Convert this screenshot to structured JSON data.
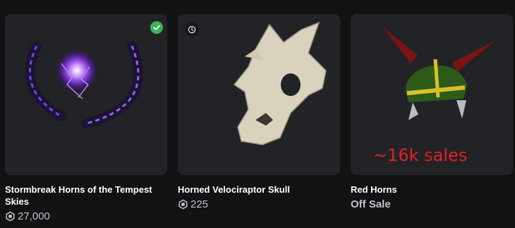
{
  "items": [
    {
      "name": "Stormbreak Horns of the Tempest Skies",
      "price": "27,000",
      "badge_icon": "checkmark-icon",
      "price_icon": "robux-icon"
    },
    {
      "name": "Horned Velociraptor Skull",
      "price": "225",
      "badge_icon": "clock-icon",
      "price_icon": "robux-icon"
    },
    {
      "name": "Red Horns",
      "status": "Off Sale",
      "annotation": "~16k sales"
    }
  ],
  "colors": {
    "background": "#111214",
    "card": "#222327",
    "owned_badge": "#3bb35c",
    "annotation": "#e02020",
    "price_text": "#bfc2c7"
  }
}
